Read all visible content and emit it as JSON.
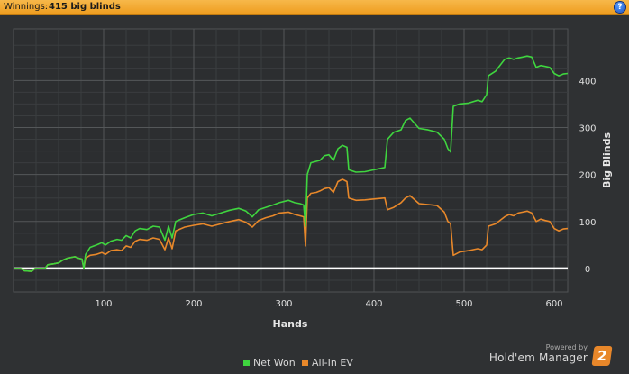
{
  "header": {
    "label": "Winnings:",
    "value": "415 big blinds",
    "help_icon": "help-icon",
    "help_glyph": "?"
  },
  "chart_data": {
    "type": "line",
    "xlabel": "Hands",
    "ylabel": "Big Blinds",
    "xlim": [
      0,
      615
    ],
    "ylim": [
      -50,
      510
    ],
    "xticks": [
      100,
      200,
      300,
      400,
      500,
      600
    ],
    "yticks": [
      0,
      100,
      200,
      300,
      400
    ],
    "grid": true,
    "legend_position": "bottom",
    "series": [
      {
        "name": "Net Won",
        "color": "#3fd53f",
        "points": [
          [
            0,
            0
          ],
          [
            8,
            0
          ],
          [
            12,
            -5
          ],
          [
            20,
            -6
          ],
          [
            24,
            0
          ],
          [
            28,
            0
          ],
          [
            35,
            0
          ],
          [
            38,
            8
          ],
          [
            45,
            10
          ],
          [
            50,
            12
          ],
          [
            55,
            18
          ],
          [
            60,
            22
          ],
          [
            68,
            25
          ],
          [
            72,
            22
          ],
          [
            76,
            20
          ],
          [
            78,
            0
          ],
          [
            80,
            30
          ],
          [
            85,
            45
          ],
          [
            92,
            50
          ],
          [
            98,
            55
          ],
          [
            102,
            50
          ],
          [
            108,
            58
          ],
          [
            115,
            62
          ],
          [
            120,
            60
          ],
          [
            125,
            70
          ],
          [
            130,
            65
          ],
          [
            135,
            80
          ],
          [
            140,
            85
          ],
          [
            148,
            83
          ],
          [
            155,
            90
          ],
          [
            162,
            88
          ],
          [
            168,
            60
          ],
          [
            172,
            90
          ],
          [
            176,
            65
          ],
          [
            180,
            100
          ],
          [
            190,
            108
          ],
          [
            200,
            115
          ],
          [
            210,
            118
          ],
          [
            220,
            112
          ],
          [
            230,
            118
          ],
          [
            240,
            124
          ],
          [
            250,
            128
          ],
          [
            258,
            122
          ],
          [
            265,
            110
          ],
          [
            272,
            125
          ],
          [
            280,
            130
          ],
          [
            288,
            135
          ],
          [
            295,
            140
          ],
          [
            305,
            145
          ],
          [
            312,
            140
          ],
          [
            318,
            138
          ],
          [
            322,
            135
          ],
          [
            324,
            90
          ],
          [
            326,
            200
          ],
          [
            330,
            225
          ],
          [
            336,
            228
          ],
          [
            340,
            230
          ],
          [
            345,
            240
          ],
          [
            350,
            242
          ],
          [
            355,
            230
          ],
          [
            360,
            255
          ],
          [
            365,
            262
          ],
          [
            370,
            258
          ],
          [
            372,
            210
          ],
          [
            380,
            205
          ],
          [
            390,
            206
          ],
          [
            400,
            210
          ],
          [
            412,
            215
          ],
          [
            415,
            275
          ],
          [
            422,
            290
          ],
          [
            430,
            295
          ],
          [
            435,
            315
          ],
          [
            440,
            320
          ],
          [
            450,
            298
          ],
          [
            460,
            295
          ],
          [
            470,
            290
          ],
          [
            478,
            275
          ],
          [
            482,
            255
          ],
          [
            485,
            248
          ],
          [
            488,
            345
          ],
          [
            495,
            350
          ],
          [
            505,
            352
          ],
          [
            515,
            358
          ],
          [
            520,
            355
          ],
          [
            525,
            370
          ],
          [
            527,
            410
          ],
          [
            535,
            420
          ],
          [
            545,
            445
          ],
          [
            550,
            448
          ],
          [
            555,
            445
          ],
          [
            560,
            448
          ],
          [
            565,
            450
          ],
          [
            570,
            452
          ],
          [
            575,
            450
          ],
          [
            580,
            428
          ],
          [
            585,
            432
          ],
          [
            590,
            430
          ],
          [
            595,
            428
          ],
          [
            600,
            415
          ],
          [
            605,
            410
          ],
          [
            610,
            414
          ],
          [
            615,
            415
          ]
        ]
      },
      {
        "name": "All-In EV",
        "color": "#e8882a",
        "points": [
          [
            0,
            0
          ],
          [
            8,
            0
          ],
          [
            12,
            -5
          ],
          [
            20,
            -6
          ],
          [
            24,
            0
          ],
          [
            28,
            0
          ],
          [
            35,
            0
          ],
          [
            38,
            8
          ],
          [
            45,
            10
          ],
          [
            50,
            12
          ],
          [
            55,
            18
          ],
          [
            60,
            22
          ],
          [
            68,
            25
          ],
          [
            72,
            22
          ],
          [
            76,
            20
          ],
          [
            78,
            0
          ],
          [
            80,
            22
          ],
          [
            85,
            28
          ],
          [
            92,
            30
          ],
          [
            98,
            34
          ],
          [
            102,
            30
          ],
          [
            108,
            38
          ],
          [
            115,
            40
          ],
          [
            120,
            38
          ],
          [
            125,
            48
          ],
          [
            130,
            45
          ],
          [
            135,
            58
          ],
          [
            140,
            62
          ],
          [
            148,
            60
          ],
          [
            155,
            65
          ],
          [
            162,
            62
          ],
          [
            168,
            40
          ],
          [
            172,
            65
          ],
          [
            176,
            42
          ],
          [
            180,
            80
          ],
          [
            190,
            88
          ],
          [
            200,
            92
          ],
          [
            210,
            95
          ],
          [
            220,
            90
          ],
          [
            230,
            95
          ],
          [
            240,
            100
          ],
          [
            250,
            104
          ],
          [
            258,
            98
          ],
          [
            265,
            88
          ],
          [
            272,
            102
          ],
          [
            280,
            108
          ],
          [
            288,
            112
          ],
          [
            295,
            118
          ],
          [
            305,
            120
          ],
          [
            312,
            115
          ],
          [
            318,
            112
          ],
          [
            322,
            110
          ],
          [
            324,
            48
          ],
          [
            326,
            150
          ],
          [
            330,
            160
          ],
          [
            336,
            162
          ],
          [
            340,
            165
          ],
          [
            345,
            170
          ],
          [
            350,
            172
          ],
          [
            355,
            162
          ],
          [
            360,
            185
          ],
          [
            365,
            190
          ],
          [
            370,
            185
          ],
          [
            372,
            150
          ],
          [
            380,
            145
          ],
          [
            390,
            146
          ],
          [
            400,
            148
          ],
          [
            412,
            150
          ],
          [
            415,
            125
          ],
          [
            422,
            130
          ],
          [
            430,
            140
          ],
          [
            435,
            150
          ],
          [
            440,
            155
          ],
          [
            450,
            138
          ],
          [
            460,
            136
          ],
          [
            470,
            134
          ],
          [
            478,
            120
          ],
          [
            482,
            100
          ],
          [
            485,
            95
          ],
          [
            488,
            28
          ],
          [
            495,
            35
          ],
          [
            505,
            38
          ],
          [
            515,
            42
          ],
          [
            520,
            40
          ],
          [
            525,
            50
          ],
          [
            527,
            90
          ],
          [
            535,
            95
          ],
          [
            545,
            110
          ],
          [
            550,
            115
          ],
          [
            555,
            112
          ],
          [
            560,
            118
          ],
          [
            565,
            120
          ],
          [
            570,
            122
          ],
          [
            575,
            118
          ],
          [
            580,
            100
          ],
          [
            585,
            105
          ],
          [
            590,
            102
          ],
          [
            595,
            100
          ],
          [
            600,
            85
          ],
          [
            605,
            80
          ],
          [
            610,
            84
          ],
          [
            615,
            85
          ]
        ]
      }
    ]
  },
  "branding": {
    "powered_by": "Powered by",
    "name": "Hold'em Manager",
    "badge": "2"
  }
}
